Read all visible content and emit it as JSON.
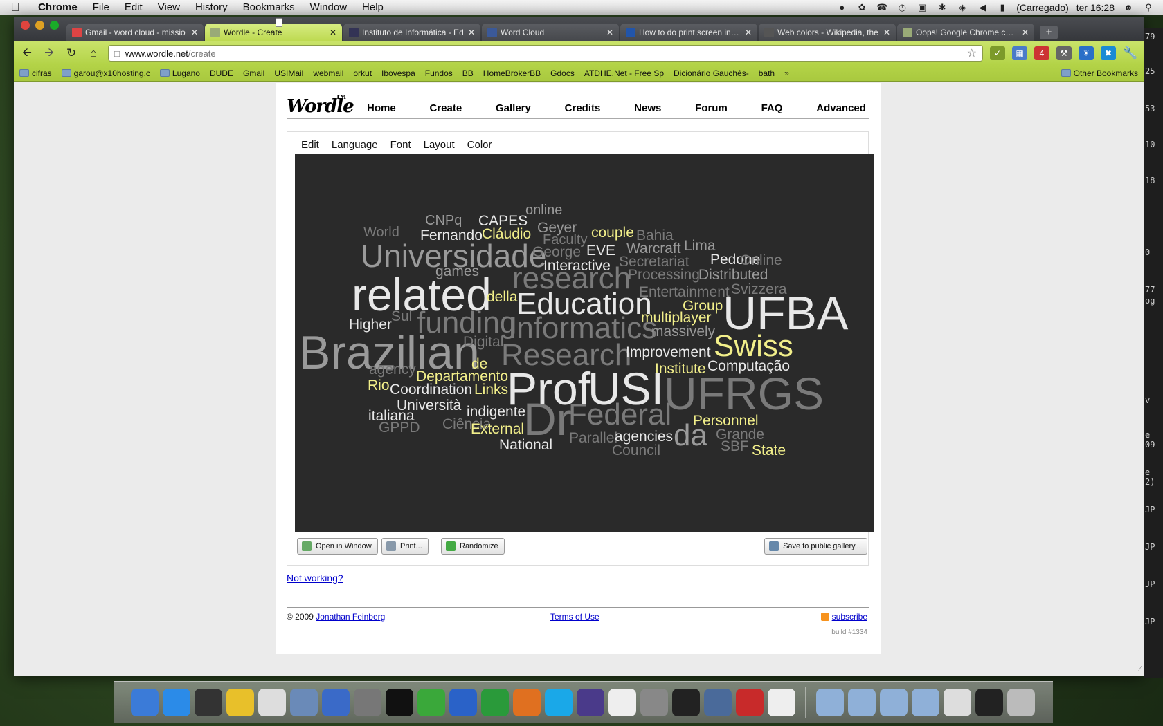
{
  "menubar": {
    "app": "Chrome",
    "items": [
      "File",
      "Edit",
      "View",
      "History",
      "Bookmarks",
      "Window",
      "Help"
    ],
    "battery": "(Carregado)",
    "clock": "ter 16:28"
  },
  "tabs": [
    {
      "title": "Gmail - word cloud - missio",
      "color": "#d44"
    },
    {
      "title": "Wordle - Create",
      "color": "#9a7",
      "active": true
    },
    {
      "title": "Instituto de Informática - Ed",
      "color": "#335"
    },
    {
      "title": "Word Cloud",
      "color": "#3b5998"
    },
    {
      "title": "How to do print screen in Ma",
      "color": "#2255aa"
    },
    {
      "title": "Web colors - Wikipedia, the",
      "color": "#555"
    },
    {
      "title": "Oops! Google Chrome could",
      "color": "#9a7"
    }
  ],
  "omnibox": {
    "host": "www.wordle.net",
    "path": "/create"
  },
  "bookmarks": [
    {
      "label": "cifras",
      "type": "folder"
    },
    {
      "label": "garou@x10hosting.c",
      "type": "folder"
    },
    {
      "label": "Lugano",
      "type": "folder"
    },
    {
      "label": "DUDE",
      "type": "page"
    },
    {
      "label": "Gmail",
      "type": "page"
    },
    {
      "label": "USIMail",
      "type": "page"
    },
    {
      "label": "webmail",
      "type": "page"
    },
    {
      "label": "orkut",
      "type": "page"
    },
    {
      "label": "Ibovespa",
      "type": "page"
    },
    {
      "label": "Fundos",
      "type": "page"
    },
    {
      "label": "BB",
      "type": "page"
    },
    {
      "label": "HomeBrokerBB",
      "type": "page"
    },
    {
      "label": "Gdocs",
      "type": "page"
    },
    {
      "label": "ATDHE.Net - Free Sp",
      "type": "page"
    },
    {
      "label": "Dicionário Gauchês-",
      "type": "page"
    },
    {
      "label": "bath",
      "type": "page"
    }
  ],
  "bookmarks_other": "Other Bookmarks",
  "wordle": {
    "logo": "Wordle",
    "tm": "TM",
    "nav": [
      "Home",
      "Create",
      "Gallery",
      "Credits",
      "News",
      "Forum",
      "FAQ",
      "Advanced"
    ],
    "applet_menu": [
      "Edit",
      "Language",
      "Font",
      "Layout",
      "Color"
    ],
    "buttons": {
      "open": "Open in Window",
      "print": "Print...",
      "randomize": "Randomize",
      "save": "Save to public gallery..."
    },
    "not_working": "Not working?",
    "footer": {
      "copyright": "© 2009",
      "author": "Jonathan Feinberg",
      "terms": "Terms of Use",
      "subscribe": "subscribe",
      "build": "build #1334"
    }
  },
  "colors": {
    "white": "#e8e8e8",
    "gray": "#9a9a9a",
    "yellow": "#f2ef8a",
    "dark": "#7a7a7a"
  },
  "cloud": [
    {
      "text": "online",
      "c": "gray",
      "s": 20
    },
    {
      "text": "CNPq",
      "c": "gray",
      "s": 20
    },
    {
      "text": "CAPES",
      "c": "white",
      "s": 21
    },
    {
      "text": "World",
      "c": "dark",
      "s": 20
    },
    {
      "text": "Fernando",
      "c": "white",
      "s": 21
    },
    {
      "text": "Cláudio",
      "c": "yellow",
      "s": 21
    },
    {
      "text": "Geyer",
      "c": "gray",
      "s": 21
    },
    {
      "text": "couple",
      "c": "yellow",
      "s": 21
    },
    {
      "text": "Bahia",
      "c": "dark",
      "s": 21
    },
    {
      "text": "Faculty",
      "c": "dark",
      "s": 20
    },
    {
      "text": "Universidade",
      "c": "gray",
      "s": 46
    },
    {
      "text": "George",
      "c": "dark",
      "s": 21
    },
    {
      "text": "EVE",
      "c": "white",
      "s": 21
    },
    {
      "text": "Warcraft",
      "c": "gray",
      "s": 21
    },
    {
      "text": "Lima",
      "c": "gray",
      "s": 21
    },
    {
      "text": "Pedone",
      "c": "white",
      "s": 21
    },
    {
      "text": "Online",
      "c": "dark",
      "s": 21
    },
    {
      "text": "Secretariat",
      "c": "dark",
      "s": 21
    },
    {
      "text": "Interactive",
      "c": "white",
      "s": 21
    },
    {
      "text": "games",
      "c": "gray",
      "s": 21
    },
    {
      "text": "research",
      "c": "dark",
      "s": 44
    },
    {
      "text": "Processing",
      "c": "dark",
      "s": 21
    },
    {
      "text": "Distributed",
      "c": "gray",
      "s": 21
    },
    {
      "text": "related",
      "c": "white",
      "s": 66
    },
    {
      "text": "Entertainment",
      "c": "dark",
      "s": 21
    },
    {
      "text": "Svizzera",
      "c": "dark",
      "s": 21
    },
    {
      "text": "della",
      "c": "yellow",
      "s": 21
    },
    {
      "text": "Education",
      "c": "white",
      "s": 44
    },
    {
      "text": "Group",
      "c": "yellow",
      "s": 21
    },
    {
      "text": "UFBA",
      "c": "white",
      "s": 68
    },
    {
      "text": "Sul",
      "c": "dark",
      "s": 21
    },
    {
      "text": "funding",
      "c": "dark",
      "s": 44
    },
    {
      "text": "multiplayer",
      "c": "yellow",
      "s": 21
    },
    {
      "text": "Higher",
      "c": "white",
      "s": 21
    },
    {
      "text": "Informatics",
      "c": "dark",
      "s": 44
    },
    {
      "text": "massively",
      "c": "gray",
      "s": 21
    },
    {
      "text": "Brazilian",
      "c": "gray",
      "s": 68
    },
    {
      "text": "Swiss",
      "c": "yellow",
      "s": 44
    },
    {
      "text": "Digital",
      "c": "dark",
      "s": 21
    },
    {
      "text": "Research",
      "c": "dark",
      "s": 44
    },
    {
      "text": "Improvement",
      "c": "white",
      "s": 21
    },
    {
      "text": "de",
      "c": "yellow",
      "s": 21
    },
    {
      "text": "agency",
      "c": "dark",
      "s": 21
    },
    {
      "text": "Institute",
      "c": "yellow",
      "s": 21
    },
    {
      "text": "Computação",
      "c": "white",
      "s": 21
    },
    {
      "text": "Departamento",
      "c": "yellow",
      "s": 21
    },
    {
      "text": "Rio",
      "c": "yellow",
      "s": 21
    },
    {
      "text": "Coordination",
      "c": "white",
      "s": 21
    },
    {
      "text": "Links",
      "c": "yellow",
      "s": 21
    },
    {
      "text": "Prof",
      "c": "white",
      "s": 66
    },
    {
      "text": "USI",
      "c": "white",
      "s": 66
    },
    {
      "text": "UFRGS",
      "c": "dark",
      "s": 66
    },
    {
      "text": "Università",
      "c": "white",
      "s": 21
    },
    {
      "text": "italiana",
      "c": "white",
      "s": 21
    },
    {
      "text": "indigente",
      "c": "white",
      "s": 21
    },
    {
      "text": "Dr",
      "c": "dark",
      "s": 66
    },
    {
      "text": "Federal",
      "c": "dark",
      "s": 44
    },
    {
      "text": "Personnel",
      "c": "yellow",
      "s": 21
    },
    {
      "text": "GPPD",
      "c": "dark",
      "s": 21
    },
    {
      "text": "Ciência",
      "c": "dark",
      "s": 21
    },
    {
      "text": "External",
      "c": "yellow",
      "s": 21
    },
    {
      "text": "Grande",
      "c": "dark",
      "s": 21
    },
    {
      "text": "Parallel",
      "c": "dark",
      "s": 21
    },
    {
      "text": "agencies",
      "c": "white",
      "s": 21
    },
    {
      "text": "da",
      "c": "gray",
      "s": 44
    },
    {
      "text": "SBF",
      "c": "dark",
      "s": 21
    },
    {
      "text": "National",
      "c": "white",
      "s": 21
    },
    {
      "text": "Council",
      "c": "dark",
      "s": 21
    },
    {
      "text": "State",
      "c": "yellow",
      "s": 21
    }
  ],
  "edge_text": [
    "79",
    "25",
    "53",
    "10",
    "18",
    "0_",
    "77",
    "og",
    "v",
    "e",
    "09",
    "e",
    "2)",
    "JP",
    "JP",
    "JP",
    "JP"
  ],
  "dock": [
    "Finder",
    "App Store",
    "Dashboard",
    "Chrome",
    "iCal",
    "iPhoto",
    "iTunes",
    "System Preferences",
    "Terminal",
    "uTorrent",
    "Word",
    "Excel",
    "PowerPoint",
    "Skype",
    "Eclipse",
    "TextEdit",
    "LaTeX",
    "Inkscape",
    "Automator",
    "Miro",
    "Java"
  ]
}
